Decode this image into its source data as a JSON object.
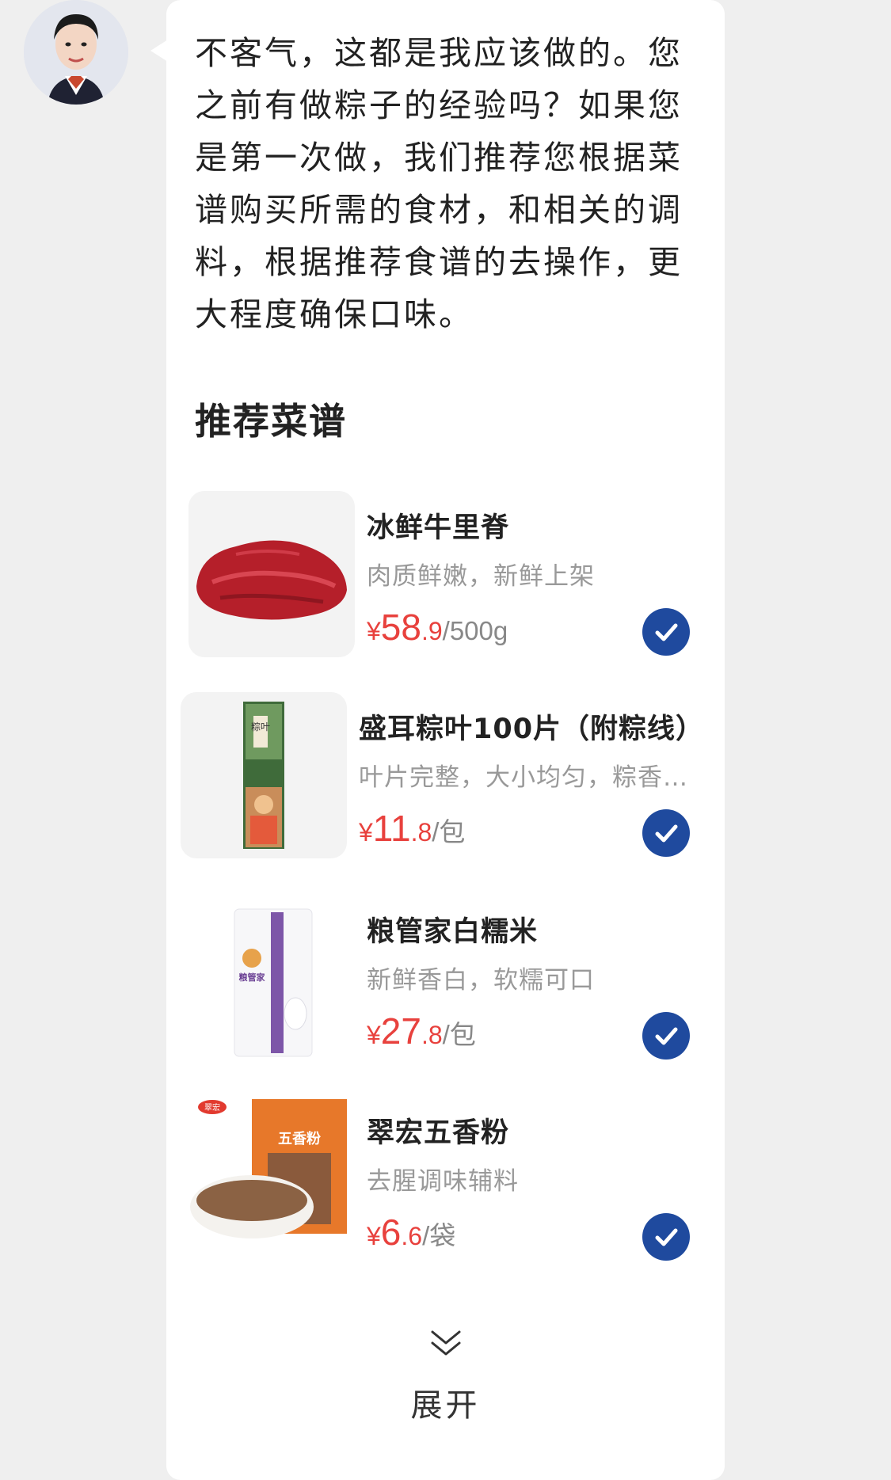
{
  "message": {
    "text": "不客气，这都是我应该做的。您之前有做粽子的经验吗？如果您是第一次做，我们推荐您根据菜谱购买所需的食材，和相关的调料，根据推荐食谱的去操作，更大程度确保口味。"
  },
  "section": {
    "title": "推荐菜谱"
  },
  "products": [
    {
      "name": "冰鲜牛里脊",
      "desc": "肉质鲜嫩，新鲜上架",
      "currency": "¥",
      "price_int": "58",
      "price_dec": ".9",
      "unit": "/500g",
      "selected": true,
      "icon": "beef-image"
    },
    {
      "name": "盛耳粽叶100片（附粽线）",
      "desc": "叶片完整，大小均匀，粽香…",
      "currency": "¥",
      "price_int": "11",
      "price_dec": ".8",
      "unit": "/包",
      "selected": true,
      "icon": "zongzi-leaf-package-image",
      "pack_text": "粽叶"
    },
    {
      "name": "粮管家白糯米",
      "desc": "新鲜香白，软糯可口",
      "currency": "¥",
      "price_int": "27",
      "price_dec": ".8",
      "unit": "/包",
      "selected": true,
      "icon": "rice-bag-image",
      "pack_text": "粮管家"
    },
    {
      "name": "翠宏五香粉",
      "desc": "去腥调味辅料",
      "currency": "¥",
      "price_int": "6",
      "price_dec": ".6",
      "unit": "/袋",
      "selected": true,
      "icon": "spice-powder-image",
      "pack_text": "五香粉",
      "logo_text": "翠宏"
    }
  ],
  "expand": {
    "label": "展开"
  },
  "colors": {
    "price": "#e8413d",
    "check": "#1f4a9e",
    "background": "#efefef",
    "bubble": "#ffffff"
  }
}
